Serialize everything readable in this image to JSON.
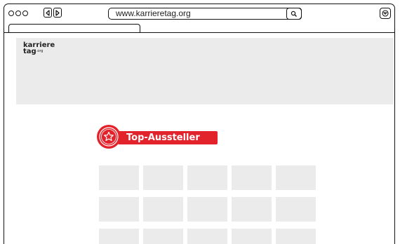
{
  "browser": {
    "url": "www.karrieretag.org",
    "window_dots": [
      "red-dot",
      "yellow-dot",
      "green-dot"
    ],
    "icons": {
      "back": "back-arrow-icon",
      "forward": "forward-arrow-icon",
      "search": "search-icon",
      "menu": "menu-icon"
    }
  },
  "header": {
    "logo_line1": "karriere",
    "logo_line2": "tag",
    "logo_sup": ".org"
  },
  "badge": {
    "label": "Top-Aussteller",
    "icon": "star-icon",
    "color": "#e3232b"
  },
  "grid": {
    "rows": 3,
    "columns": 5,
    "placeholder_color": "#ebebeb"
  }
}
